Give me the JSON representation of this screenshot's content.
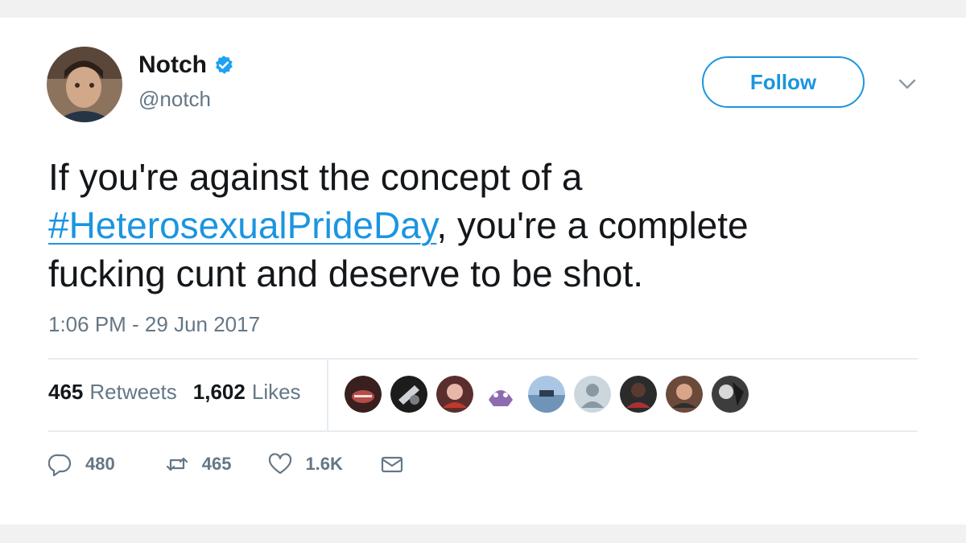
{
  "author": {
    "name": "Notch",
    "handle": "@notch",
    "verified": true,
    "avatar_icon": "profile-photo"
  },
  "follow_button": {
    "label": "Follow"
  },
  "menu_icon": "chevron-down-icon",
  "tweet": {
    "line1": "If you're against the concept of a",
    "hashtag": "#HeterosexualPrideDay",
    "line2_rest": ", you're a complete",
    "line3": "fucking cunt and deserve to be shot."
  },
  "timestamp": "1:06 PM - 29 Jun 2017",
  "stats": {
    "retweets_count": "465",
    "retweets_label": "Retweets",
    "likes_count": "1,602",
    "likes_label": "Likes"
  },
  "actions": {
    "reply_count": "480",
    "retweet_count": "465",
    "like_count": "1.6K"
  },
  "colors": {
    "accent": "#1b95e0",
    "text": "#14171a",
    "muted": "#657786",
    "divider": "#e6ecf0"
  }
}
